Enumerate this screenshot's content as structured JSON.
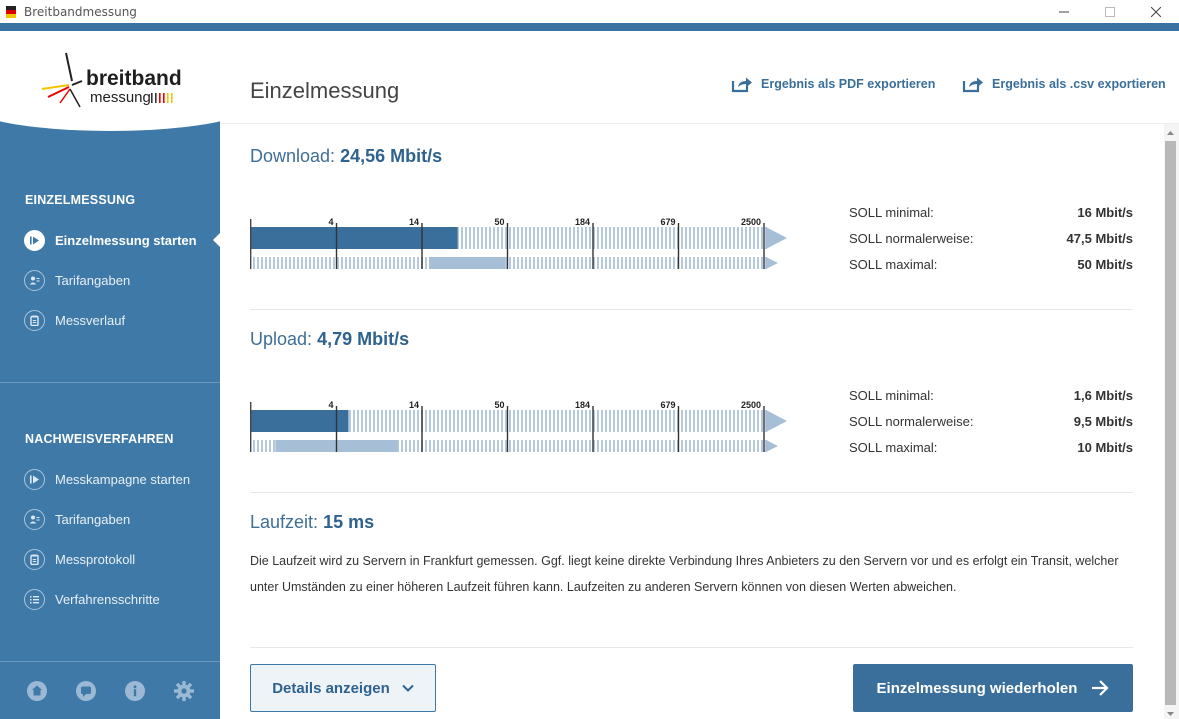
{
  "window": {
    "title": "Breitbandmessung"
  },
  "logo": {
    "line1": "breitband",
    "line2": "messung"
  },
  "sidebar": {
    "section1": "EINZELMESSUNG",
    "items1": [
      {
        "label": "Einzelmessung starten",
        "icon": "play-icon"
      },
      {
        "label": "Tarifangaben",
        "icon": "user-card-icon"
      },
      {
        "label": "Messverlauf",
        "icon": "clipboard-icon"
      }
    ],
    "section2": "NACHWEISVERFAHREN",
    "items2": [
      {
        "label": "Messkampagne starten",
        "icon": "play-icon"
      },
      {
        "label": "Tarifangaben",
        "icon": "user-card-icon"
      },
      {
        "label": "Messprotokoll",
        "icon": "clipboard-icon"
      },
      {
        "label": "Verfahrensschritte",
        "icon": "list-icon"
      }
    ],
    "footer_icons": [
      "home-icon",
      "chat-icon",
      "info-icon",
      "gear-icon"
    ]
  },
  "header": {
    "title": "Einzelmessung",
    "export_pdf": "Ergebnis als PDF exportieren",
    "export_csv": "Ergebnis als .csv exportieren"
  },
  "ticks": [
    "4",
    "14",
    "50",
    "184",
    "679",
    "2500"
  ],
  "download": {
    "label": "Download:",
    "value": "24,56 Mbit/s",
    "measured_mbits": 24.56,
    "soll_min_mbits": 16,
    "soll_max_mbits": 50,
    "soll": [
      {
        "label": "SOLL minimal:",
        "value": "16 Mbit/s"
      },
      {
        "label": "SOLL normalerweise:",
        "value": "47,5 Mbit/s"
      },
      {
        "label": "SOLL maximal:",
        "value": "50 Mbit/s"
      }
    ]
  },
  "upload": {
    "label": "Upload:",
    "value": "4,79 Mbit/s",
    "measured_mbits": 4.79,
    "soll_min_mbits": 1.6,
    "soll_max_mbits": 10,
    "soll": [
      {
        "label": "SOLL minimal:",
        "value": "1,6 Mbit/s"
      },
      {
        "label": "SOLL normalerweise:",
        "value": "9,5 Mbit/s"
      },
      {
        "label": "SOLL maximal:",
        "value": "10 Mbit/s"
      }
    ]
  },
  "runtime": {
    "label": "Laufzeit:",
    "value": "15 ms",
    "description": "Die Laufzeit wird zu Servern in Frankfurt gemessen. Ggf. liegt keine direkte Verbindung Ihres Anbieters zu den Servern vor und es erfolgt ein Transit, welcher unter Umständen zu einer höheren Laufzeit führen kann. Laufzeiten zu anderen Servern können von diesen Werten abweichen."
  },
  "buttons": {
    "details": "Details anzeigen",
    "repeat": "Einzelmessung wiederholen"
  },
  "colors": {
    "sidebar": "#3f79a8",
    "accent": "#3a6f9c",
    "bar_measured": "#3a6f9c",
    "bar_soll": "#a7bfd6",
    "stripe": "#b5c9dc"
  }
}
